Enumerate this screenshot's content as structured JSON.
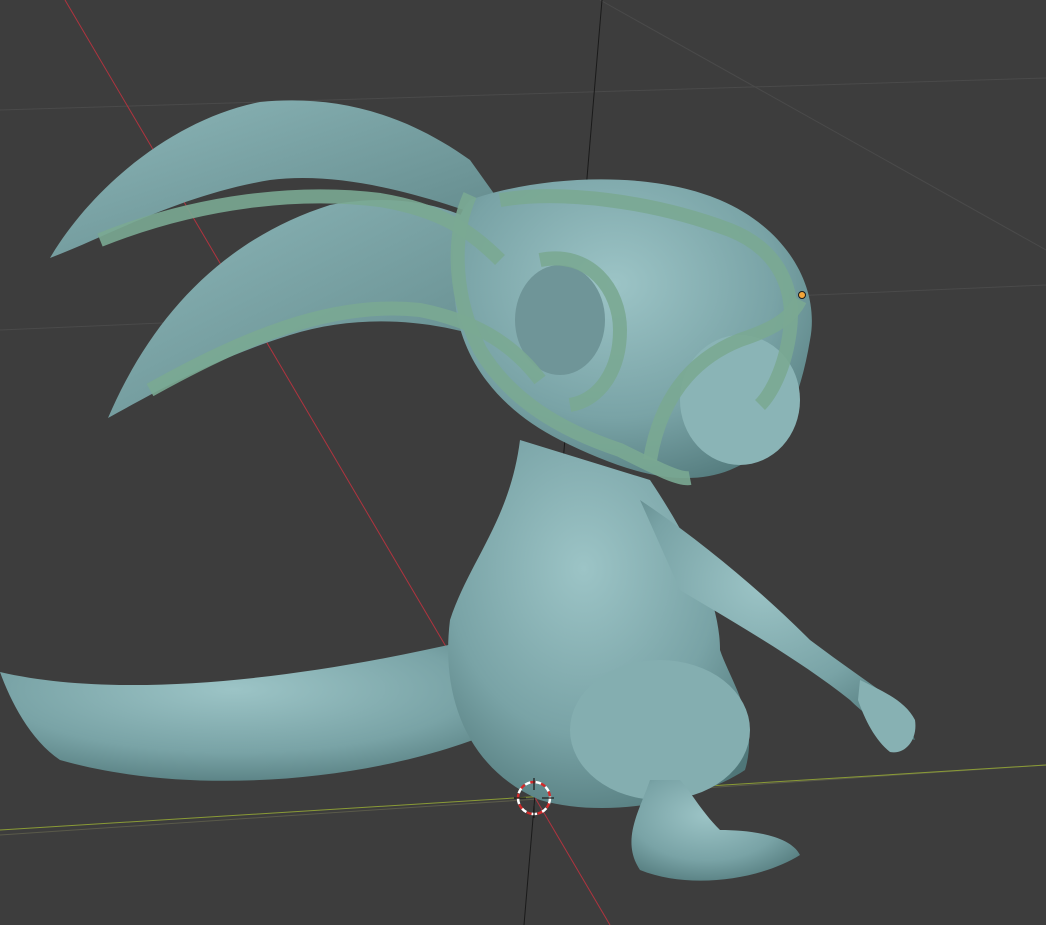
{
  "app": "3D viewport",
  "view": {
    "background": "#3d3d3d",
    "grid_color": "#4a4a4a",
    "x_axis_color": "#b0343f",
    "y_axis_color": "#8a9b36",
    "z_axis_color": "#1a1a1a"
  },
  "objects": [
    {
      "name": "creature-sculpt",
      "color": "#79a3a6",
      "selected": false
    },
    {
      "name": "head-guide-curves",
      "color": "#7aa892",
      "selected": true
    }
  ],
  "cursor": {
    "name": "3d-cursor"
  },
  "origin_marker_color": "#f2a53a"
}
